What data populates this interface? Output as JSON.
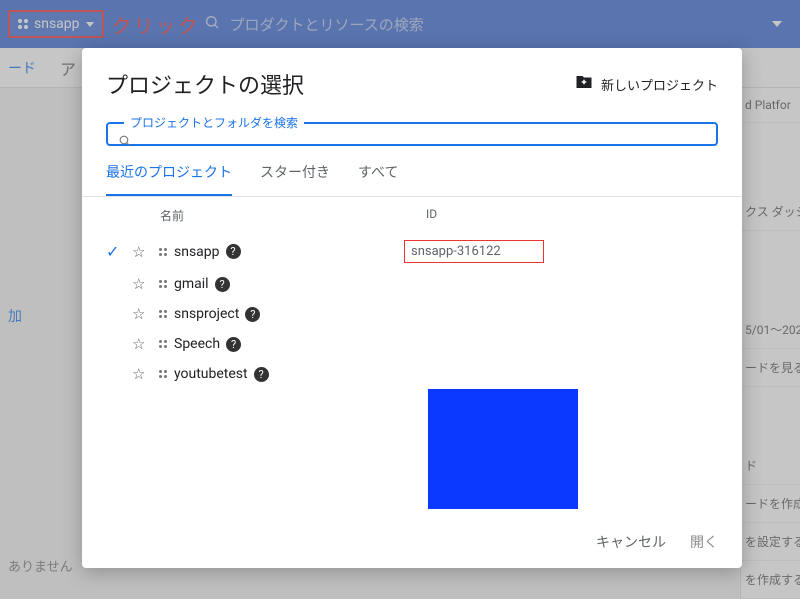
{
  "topbar": {
    "project_name": "snsapp",
    "callout_label": "クリック",
    "search_placeholder": "プロダクトとリソースの検索"
  },
  "background": {
    "tab_label": "ード",
    "right_items": [
      "d Platfor",
      "クス ダッシ",
      "5/01～202",
      "ードを見る",
      "ド",
      "ードを作成す",
      "を設定する",
      "を作成する"
    ],
    "add_label": "加",
    "bottom_label": "ありません"
  },
  "modal": {
    "title": "プロジェクトの選択",
    "new_project_label": "新しいプロジェクト",
    "search_label": "プロジェクトとフォルダを検索",
    "tabs": {
      "recent": "最近のプロジェクト",
      "starred": "スター付き",
      "all": "すべて"
    },
    "columns": {
      "name": "名前",
      "id": "ID"
    },
    "rows": [
      {
        "name": "snsapp",
        "id": "snsapp-316122",
        "selected": true
      },
      {
        "name": "gmail",
        "id": ""
      },
      {
        "name": "snsproject",
        "id": ""
      },
      {
        "name": "Speech",
        "id": ""
      },
      {
        "name": "youtubetest",
        "id": ""
      }
    ],
    "cancel_label": "キャンセル",
    "open_label": "開く"
  }
}
